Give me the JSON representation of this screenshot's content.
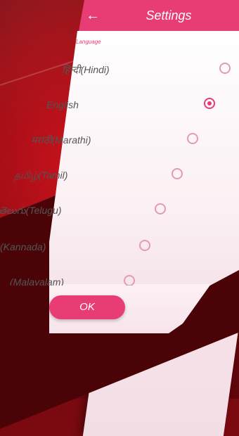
{
  "appbar": {
    "title": "Settings",
    "back_icon": "arrow-left-icon"
  },
  "section": {
    "label": "Language"
  },
  "languages": [
    {
      "label": "हिन्दी(Hindi)",
      "selected": false
    },
    {
      "label": "English",
      "selected": true
    },
    {
      "label": "मराठी(Marathi)",
      "selected": false
    },
    {
      "label": "தமிழ்(Tamil)",
      "selected": false
    },
    {
      "label": "తెలుగు(Telugu)",
      "selected": false
    },
    {
      "label": "(Kannada)",
      "selected": false
    },
    {
      "label": "(Malayalam)",
      "selected": false
    }
  ],
  "ok_button": {
    "label": "OK"
  },
  "colors": {
    "accent": "#e83c74",
    "background": "#9e0d15"
  }
}
